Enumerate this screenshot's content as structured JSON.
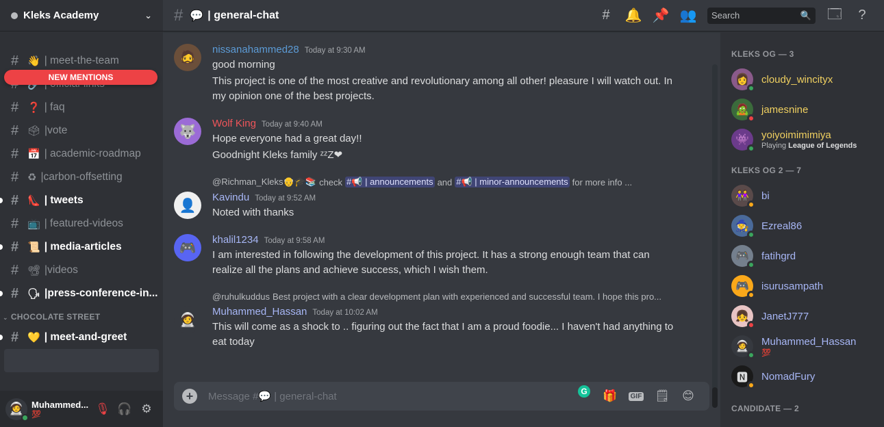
{
  "guild": {
    "name": "Kleks Academy"
  },
  "mentions_label": "NEW MENTIONS",
  "channels": [
    {
      "emoji": "👋",
      "label": "| meet-the-team",
      "unread": false
    },
    {
      "emoji": "🔗",
      "label": "| official-links",
      "unread": false
    },
    {
      "emoji": "❓",
      "label": "| faq",
      "unread": false
    },
    {
      "emoji": "🗳",
      "label": "|vote",
      "unread": false
    },
    {
      "emoji": "📅",
      "label": "| academic-roadmap",
      "unread": false
    },
    {
      "emoji": "♻",
      "label": "|carbon-offsetting",
      "unread": false
    },
    {
      "emoji": "👠",
      "label": "| tweets",
      "unread": true
    },
    {
      "emoji": "📺",
      "label": "| featured-videos",
      "unread": false
    },
    {
      "emoji": "📜",
      "label": "| media-articles",
      "unread": true
    },
    {
      "emoji": "📽",
      "label": "|videos",
      "unread": false
    },
    {
      "emoji": "🗣",
      "label": "|press-conference-in...",
      "unread": true
    }
  ],
  "category2": {
    "name": "CHOCOLATE STREET"
  },
  "channels2": [
    {
      "emoji": "💛",
      "label": "| meet-and-greet",
      "unread": true
    }
  ],
  "user": {
    "name": "Muhammed...",
    "sub": "💯"
  },
  "channel": {
    "emoji": "💬",
    "title": "| general-chat"
  },
  "search": {
    "placeholder": "Search"
  },
  "messages": [
    {
      "author": "nissanahammed28",
      "author_color": "#5c9bd6",
      "time": "Today at 9:30 AM",
      "avatar_color": "#6b4f3a",
      "lines": [
        "good morning",
        "This project is one of the most creative and revolutionary among all other! pleasure I will watch out. In my opinion one of the best projects."
      ]
    },
    {
      "author": "Wolf King",
      "author_color": "#f0555a",
      "time": "Today at 9:40 AM",
      "avatar_color": "#9b6bd6",
      "lines": [
        "Hope everyone had a great day!!",
        "Goodnight Kleks family ᶻᶻZ❤"
      ]
    },
    {
      "reply_name": "@Richman_Kleks👴🎓📚",
      "reply_text_a": "check",
      "reply_chip_a": "#📢 | announcements",
      "reply_and": "and",
      "reply_chip_b": "#📢 | minor-announcements",
      "reply_tail": "for more info ...",
      "author": "Kavindu",
      "author_color": "#a7b6f5",
      "time": "Today at 9:52 AM",
      "avatar_color": "#f0f0f0",
      "lines": [
        "Noted with thanks"
      ]
    },
    {
      "author": "khalil1234",
      "author_color": "#a7b6f5",
      "time": "Today at 9:58 AM",
      "avatar_color": "#5865f2",
      "lines": [
        "I am interested in following the development of this project. It has a strong enough team that can realize all the plans and achieve success, which I wish them."
      ]
    },
    {
      "reply_name": "@ruhulkuddus",
      "reply_text_a": "Best project with a clear development plan with experienced and successful team. I hope this pro...",
      "author": "Muhammed_Hassan",
      "author_color": "#a7b6f5",
      "time": "Today at 10:02 AM",
      "avatar_color": "#36393f",
      "lines": [
        "This will come as a shock to .. figuring out the fact that I am a proud foodie... I haven't had anything to eat today"
      ]
    }
  ],
  "composer": {
    "placeholder": "Message #💬 | general-chat"
  },
  "members": {
    "cat1": "KLEKS OG — 3",
    "group1": [
      {
        "name": "cloudy_wincityx",
        "color": "#f0d060",
        "status": "#3ba55d",
        "activity": "",
        "activity_bold": ""
      },
      {
        "name": "jamesnine",
        "color": "#f0d060",
        "status": "#ed4245",
        "activity": "",
        "activity_bold": ""
      },
      {
        "name": "yoiyoimimimiya",
        "color": "#f0d060",
        "status": "#3ba55d",
        "activity": "Playing",
        "activity_bold": "League of Legends"
      }
    ],
    "cat2": "KLEKS OG 2 — 7",
    "group2": [
      {
        "name": "bi",
        "color": "#a7b6f5",
        "status": "#faa81a"
      },
      {
        "name": "Ezreal86",
        "color": "#a7b6f5",
        "status": "#3ba55d"
      },
      {
        "name": "fatihgrd",
        "color": "#a7b6f5",
        "status": "#3ba55d"
      },
      {
        "name": "isurusampath",
        "color": "#a7b6f5",
        "status": "#faa81a"
      },
      {
        "name": "JanetJ777",
        "color": "#a7b6f5",
        "status": "#ed4245"
      },
      {
        "name": "Muhammed_Hassan",
        "color": "#a7b6f5",
        "status": "#3ba55d",
        "sub": "💯"
      },
      {
        "name": "NomadFury",
        "color": "#a7b6f5",
        "status": "#faa81a"
      }
    ],
    "cat3": "CANDIDATE — 2"
  }
}
